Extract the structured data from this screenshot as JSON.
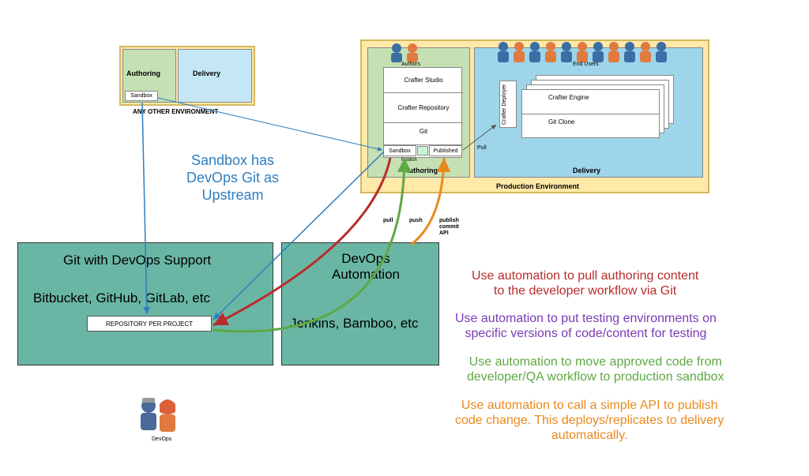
{
  "other_env": {
    "label": "ANY OTHER ENVIRONMENT",
    "authoring": "Authoring",
    "delivery": "Delivery",
    "sandbox": "Sandbox"
  },
  "prod_env": {
    "label": "Production Environment",
    "authoring": "Authoring",
    "delivery": "Delivery",
    "authors_label": "Authors",
    "endusers_label": "End Users",
    "crafter_studio": "Crafter Studio",
    "crafter_repo": "Crafter Repository",
    "git": "Git",
    "sandbox": "Sandbox",
    "published": "Published",
    "publish_action": "Publish",
    "deployer": "Crafter Deployer",
    "engine": "Crafter Engine",
    "git_clone": "Git Clone",
    "pull": "Pull"
  },
  "sandbox_note": {
    "line1": "Sandbox has",
    "line2": "DevOps Git as",
    "line3": "Upstream"
  },
  "git_box": {
    "title": "Git with DevOps Support",
    "sub": "Bitbucket, GitHub, GitLab, etc",
    "repo": "REPOSITORY PER PROJECT"
  },
  "devops_box": {
    "title1": "DevOps",
    "title2": "Automation",
    "sub": "Jenkins, Bamboo, etc"
  },
  "devops_people_label": "DevOps",
  "flow": {
    "pull": "pull",
    "push": "push",
    "api1": "publish",
    "api2": "commit",
    "api3": "API"
  },
  "notes": {
    "n1a": "Use automation to pull authoring content",
    "n1b": "to the developer workflow via Git",
    "n2a": "Use automation to put testing environments on",
    "n2b": "specific versions of code/content for testing",
    "n3a": "Use automation to move approved code from",
    "n3b": "developer/QA workflow to production sandbox",
    "n4a": "Use automation to call a simple API to publish",
    "n4b": "code change.  This deploys/replicates to delivery",
    "n4c": "automatically."
  }
}
